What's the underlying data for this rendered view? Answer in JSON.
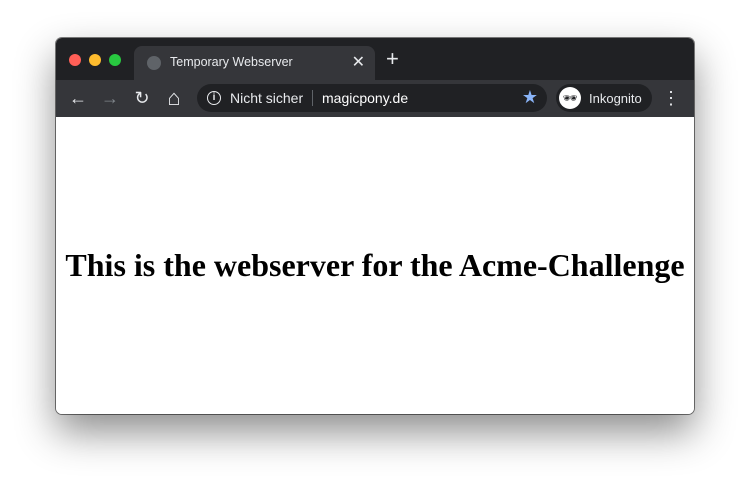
{
  "tab": {
    "title": "Temporary Webserver",
    "close": "✕"
  },
  "new_tab": "+",
  "toolbar": {
    "back": "←",
    "forward": "→",
    "reload": "↻",
    "home": "⌂",
    "menu": "⋮"
  },
  "omnibox": {
    "security_label": "Nicht sicher",
    "url": "magicpony.de",
    "info": "i",
    "star": "★"
  },
  "profile": {
    "label": "Inkognito",
    "icon": "🕶"
  },
  "page": {
    "heading": "This is the webserver for the Acme-Challenge"
  },
  "colors": {
    "close": "#ff5f57",
    "minimize": "#febc2e",
    "zoom": "#28c840",
    "star": "#8ab4f8"
  }
}
